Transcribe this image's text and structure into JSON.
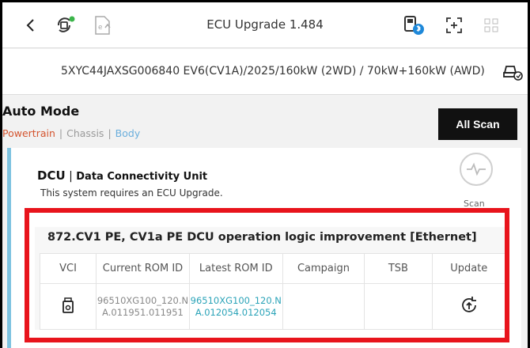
{
  "topbar": {
    "title": "ECU Upgrade 1.484",
    "icons": [
      "back-icon",
      "vci-connect-icon",
      "ecu-file-icon",
      "bluetooth-vci-icon",
      "screen-capture-icon",
      "grid-menu-icon"
    ]
  },
  "vehicle": {
    "text": "5XYC44JAXSG006840  EV6(CV1A)/2025/160kW (2WD) / 70kW+160kW (AWD)",
    "icon": "car-settings-icon"
  },
  "auto_mode": {
    "title": "Auto Mode",
    "tabs": [
      "Powertrain",
      "Chassis",
      "Body"
    ],
    "all_scan_label": "All Scan"
  },
  "dcu": {
    "code": "DCU",
    "name": "Data Connectivity Unit",
    "message": "This system requires an ECU Upgrade.",
    "scan_label": "Scan"
  },
  "upgrade": {
    "title": "872.CV1 PE, CV1a PE DCU operation logic improvement [Ethernet]",
    "headers": [
      "VCI",
      "Current ROM ID",
      "Latest ROM ID",
      "Campaign",
      "TSB",
      "Update"
    ],
    "row": {
      "current_rom": "96510XG100_120.NA.011951.011951",
      "latest_rom": "96510XG100_120.NA.012054.012054",
      "campaign": "",
      "tsb": ""
    }
  },
  "colors": {
    "powertrain": "#d4542e",
    "body": "#6aaedc",
    "latest_rom": "#2aa3b8",
    "highlight": "#e8141c",
    "card_accent": "#7ec3e0"
  }
}
